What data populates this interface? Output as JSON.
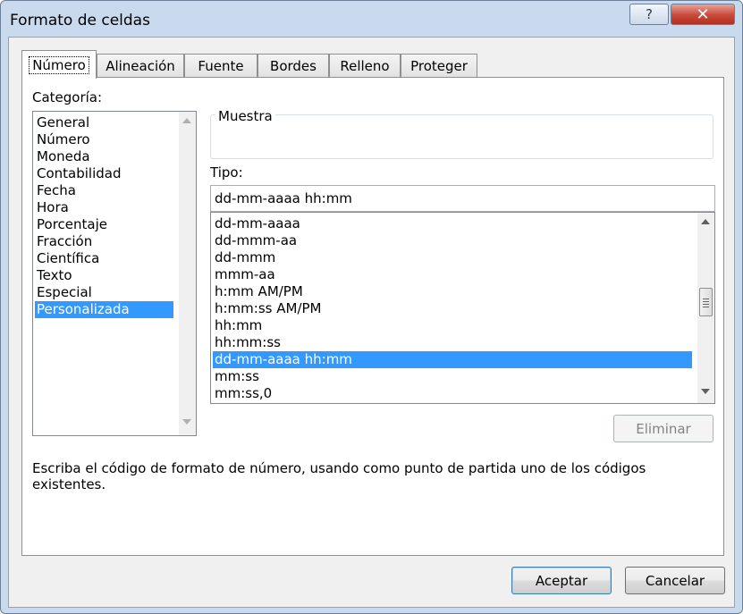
{
  "window": {
    "title": "Formato de celdas",
    "help_label": "?",
    "close_label": "✕"
  },
  "tabs": [
    {
      "label": "Número",
      "active": true
    },
    {
      "label": "Alineación"
    },
    {
      "label": "Fuente"
    },
    {
      "label": "Bordes"
    },
    {
      "label": "Relleno"
    },
    {
      "label": "Proteger"
    }
  ],
  "category": {
    "label": "Categoría:",
    "items": [
      "General",
      "Número",
      "Moneda",
      "Contabilidad",
      "Fecha",
      "Hora",
      "Porcentaje",
      "Fracción",
      "Científica",
      "Texto",
      "Especial",
      "Personalizada"
    ],
    "selected": "Personalizada"
  },
  "sample": {
    "label": "Muestra",
    "value": ""
  },
  "type": {
    "label": "Tipo:",
    "value": "dd-mm-aaaa hh:mm",
    "items": [
      "dd-mm-aaaa",
      "dd-mmm-aa",
      "dd-mmm",
      "mmm-aa",
      "h:mm AM/PM",
      "h:mm:ss AM/PM",
      "hh:mm",
      "hh:mm:ss",
      "dd-mm-aaaa hh:mm",
      "mm:ss",
      "mm:ss,0"
    ],
    "selected": "dd-mm-aaaa hh:mm"
  },
  "buttons": {
    "delete": "Eliminar",
    "ok": "Aceptar",
    "cancel": "Cancelar"
  },
  "description": "Escriba el código de formato de número, usando como punto de partida uno de los códigos existentes.",
  "colors": {
    "selection": "#3399ff",
    "window_frame": "#c9daee",
    "close_button": "#c8483a"
  }
}
